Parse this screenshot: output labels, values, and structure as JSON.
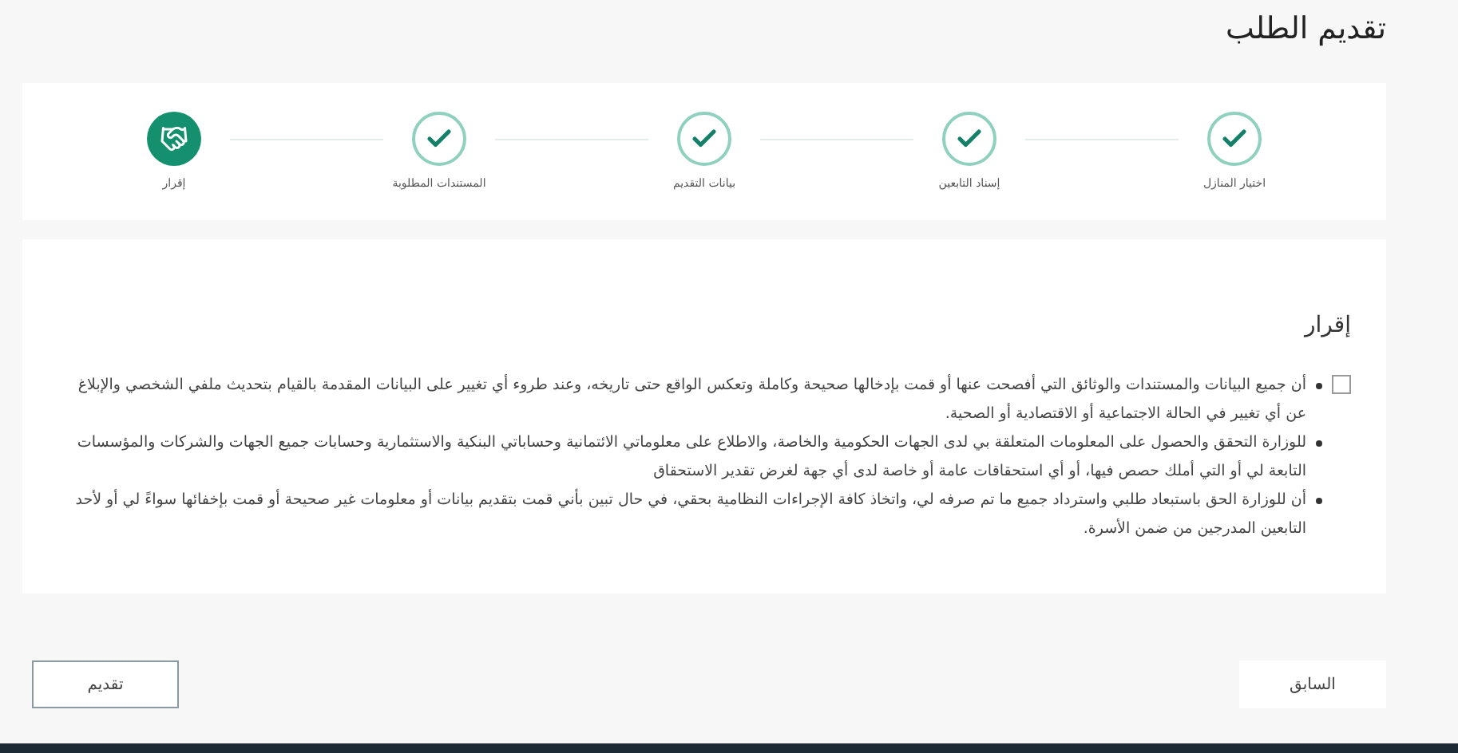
{
  "title": "تقديم الطلب",
  "steps": [
    {
      "label": "اختيار المنازل",
      "kind": "done"
    },
    {
      "label": "إسناد التابعين",
      "kind": "done"
    },
    {
      "label": "بيانات التقديم",
      "kind": "done"
    },
    {
      "label": "المستندات المطلوبة",
      "kind": "done"
    },
    {
      "label": "إقرار",
      "kind": "current"
    }
  ],
  "declaration": {
    "heading": "إقرار",
    "checked": false,
    "items": [
      "أن جميع البيانات والمستندات والوثائق التي أفصحت عنها أو قمت بإدخالها صحيحة وكاملة وتعكس الواقع حتى تاريخه، وعند طروء أي تغيير على البيانات المقدمة بالقيام بتحديث ملفي الشخصي والإبلاغ عن أي تغيير في الحالة الاجتماعية أو الاقتصادية أو الصحية.",
      "للوزارة التحقق والحصول على المعلومات المتعلقة بي لدى الجهات الحكومية والخاصة، والاطلاع على معلوماتي الائتمانية وحساباتي البنكية والاستثمارية وحسابات جميع الجهات والشركات والمؤسسات التابعة لي أو التي أملك حصص فيها، أو أي استحقاقات عامة أو خاصة لدى أي جهة لغرض تقدير الاستحقاق",
      "أن للوزارة الحق باستبعاد طلبي واسترداد جميع ما تم صرفه لي، واتخاذ كافة الإجراءات النظامية بحقي، في حال تبين بأني قمت بتقديم بيانات أو معلومات غير صحيحة أو قمت بإخفائها سواءً لي أو لأحد التابعين المدرجين من ضمن الأسرة."
    ]
  },
  "buttons": {
    "previous": "السابق",
    "submit": "تقديم"
  }
}
